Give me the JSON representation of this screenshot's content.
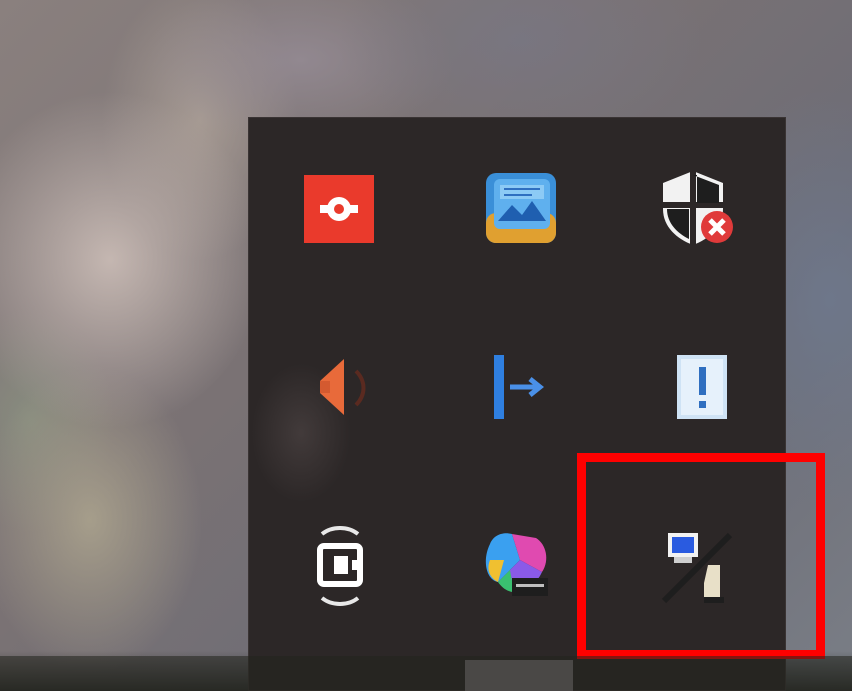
{
  "screen": {
    "desktop": {
      "wallpaper_name": "desktop-wallpaper"
    },
    "tray_overflow": {
      "title": "",
      "icons": [
        {
          "name": "red-circle-app-icon",
          "color": "#ea3a2c"
        },
        {
          "name": "gallery-app-icon",
          "color": "#3a8fd8"
        },
        {
          "name": "security-shield-warning-icon",
          "color": "#e03030"
        },
        {
          "name": "speaker-muted-icon",
          "color": "#e86a3a"
        },
        {
          "name": "exit-arrow-icon",
          "color": "#2f7fe0"
        },
        {
          "name": "clipboard-alert-icon",
          "color": "#cfe3f5"
        },
        {
          "name": "camera-capture-icon",
          "color": "#ffffff"
        },
        {
          "name": "copilot-icon",
          "color": "#7a5af0"
        },
        {
          "name": "network-disconnected-icon",
          "color": "#2a5be0"
        }
      ]
    },
    "annotation": {
      "highlight_color": "#ff0000",
      "target": "network-disconnected-icon"
    },
    "colors": {
      "flyout_background": "#2c2727",
      "taskbar": "#23241f"
    }
  }
}
